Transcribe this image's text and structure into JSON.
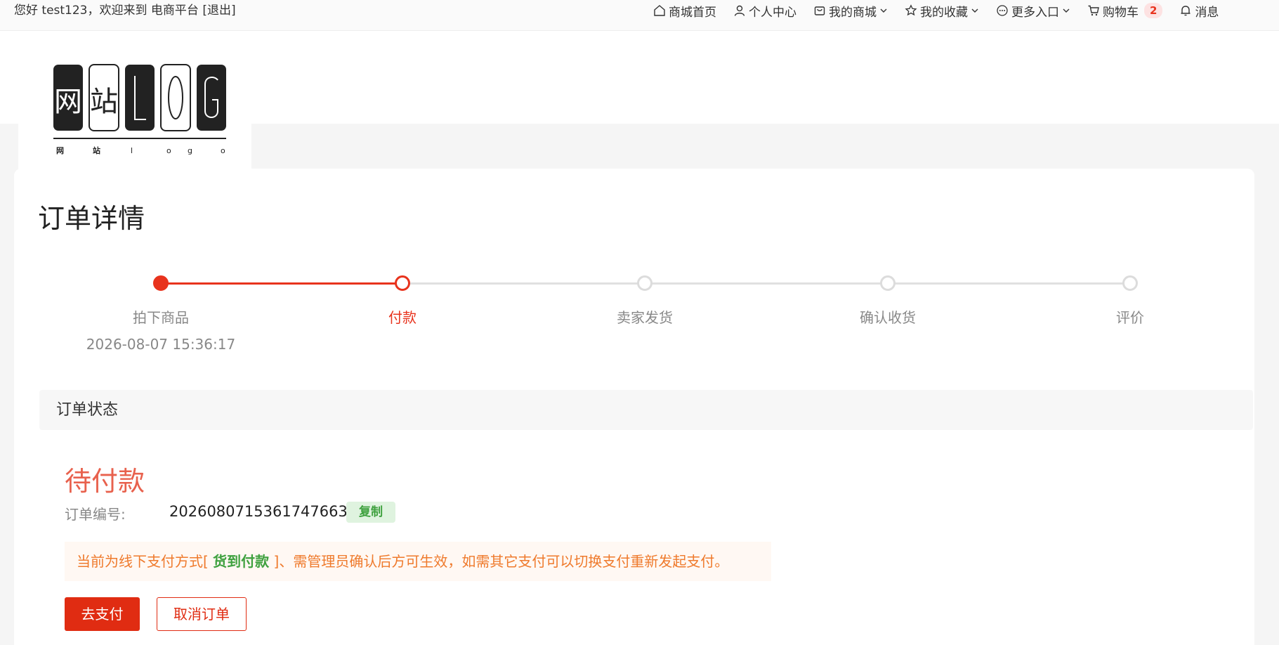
{
  "topbar": {
    "greeting_prefix": "您好 ",
    "username": "test123",
    "greeting_suffix": "，欢迎来到 电商平台 ",
    "logout": "[退出]",
    "nav": [
      {
        "label": "商城首页",
        "icon": "home-icon"
      },
      {
        "label": "个人中心",
        "icon": "user-icon"
      },
      {
        "label": "我的商城",
        "icon": "shop-bag-icon"
      },
      {
        "label": "我的收藏",
        "icon": "star-icon"
      },
      {
        "label": "更多入口",
        "icon": "more-dots-icon"
      },
      {
        "label": "购物车",
        "icon": "cart-icon"
      },
      {
        "label": "消息",
        "icon": "bell-icon"
      }
    ],
    "cart_count": "2"
  },
  "logo": {
    "text": "网站LOG",
    "subtext": "网 站 l o g o"
  },
  "page": {
    "title": "订单详情"
  },
  "steps": [
    {
      "label": "拍下商品",
      "time": "2026-08-07 15:36:17",
      "state": "done"
    },
    {
      "label": "付款",
      "state": "current"
    },
    {
      "label": "卖家发货",
      "state": "pending"
    },
    {
      "label": "确认收货",
      "state": "pending"
    },
    {
      "label": "评价",
      "state": "pending"
    }
  ],
  "order": {
    "section_title": "订单状态",
    "status": "待付款",
    "number_label": "订单编号:",
    "number": "20260807153617476638",
    "copy_label": "复制",
    "notice_prefix": "当前为线下支付方式[ ",
    "notice_method": "货到付款",
    "notice_suffix": " ]、需管理员确认后方可生效，如需其它支付可以切换支付重新发起支付。",
    "pay_button": "去支付",
    "cancel_button": "取消订单"
  },
  "colors": {
    "accent": "#e8331d",
    "status": "#e8614d",
    "notice_text": "#ef7a2c",
    "success": "#3fa13f"
  }
}
